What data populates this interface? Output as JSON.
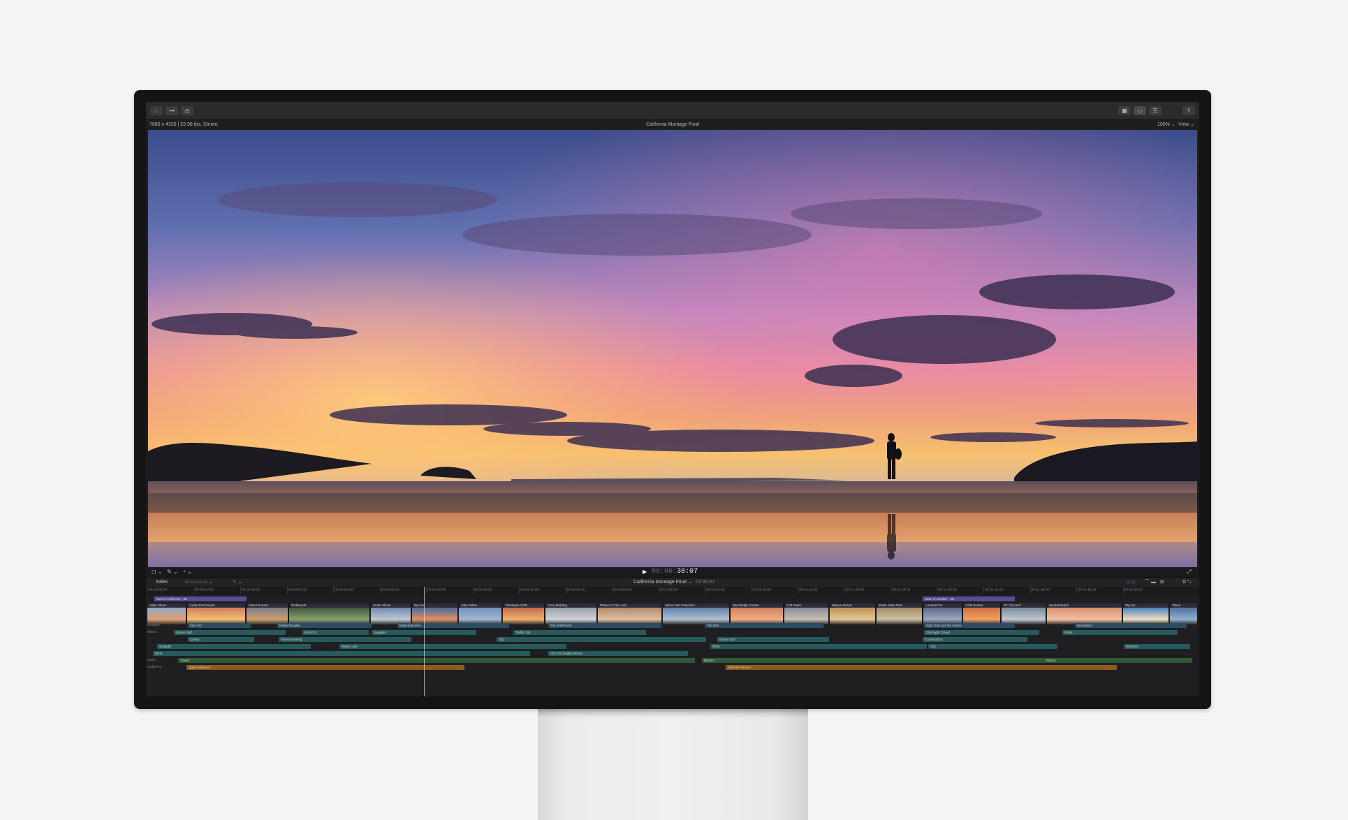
{
  "toolbar": {
    "left_icons": [
      "import-icon",
      "keywords-icon",
      "background-tasks-icon"
    ],
    "right_icons": [
      "browser-view-icon",
      "timeline-view-icon",
      "inspector-icon",
      "share-icon"
    ]
  },
  "viewer": {
    "format_info": "7680 x 4320 | 23.98 fps, Stereo",
    "title": "California Montage Final",
    "zoom": "100% ⌄",
    "view_menu": "View ⌄"
  },
  "transport": {
    "timecode_dim": "00:00:",
    "timecode": "30:07",
    "play_icon": "▶",
    "fullscreen_icon": "⤢"
  },
  "timeline_bar": {
    "index_label": "Index",
    "project_name": "California Montage Final ⌄",
    "project_duration": "01:55:07"
  },
  "ruler": [
    "00:00:05:00",
    "00:00:10:00",
    "00:00:15:00",
    "00:00:20:00",
    "00:00:25:00",
    "00:00:30:00",
    "00:00:35:00",
    "00:00:40:00",
    "00:00:45:00",
    "00:00:50:00",
    "00:00:55:00",
    "00:01:00:00",
    "00:01:05:00",
    "00:01:10:00",
    "00:01:15:00",
    "00:01:20:00",
    "00:01:25:00",
    "00:01:30:00",
    "00:01:35:00",
    "00:01:40:00",
    "00:01:45:00",
    "00:01:50:00"
  ],
  "roles": [
    "Dialogue",
    "Effects",
    "Music",
    "Ambience"
  ],
  "title_clips": [
    "Best of California - 3D",
    "State of Wonder - 3D"
  ],
  "video_clips": [
    "Misty Shore",
    "Lands End Sunset",
    "Island Sunset",
    "Redwoods",
    "South Shore",
    "Big Sur",
    "Lake Tahoe",
    "Timelapse GGB",
    "Ferry Building",
    "Palace of Fine Arts",
    "Above San Francisco",
    "Bay Bridge Sunset",
    "Coit Tower",
    "Mojave Desert",
    "Bodie State Park",
    "Lombard St.",
    "GGB Sunset",
    "SF City Hall",
    "Sunset Beach",
    "Big Sur",
    "Tahoe"
  ],
  "dialogue_clips": [
    "Intro VO",
    "Native Peoples",
    "Early Explorers",
    "The Gold Rush",
    "The 60's",
    "High Tech and the Future",
    "Recreation"
  ],
  "effects_row1": [
    "Ocean Surf",
    "Birds FX",
    "Seagulls",
    "Traffic City",
    "City Night Crowd",
    "Parks"
  ],
  "effects_row2": [
    "Crowd",
    "Forest Evening",
    "City",
    "Ocean Surf",
    "Construction"
  ],
  "effects_row3": [
    "Seagulls",
    "Water Lake",
    "Wind",
    "City",
    "Beaches"
  ],
  "effects_row4": [
    "Wind",
    "City Fire Engine Sirens"
  ],
  "music_clips": [
    "Travel",
    "Modern",
    "Nature"
  ],
  "ambience_clips": [
    "Quiet Ambience",
    "Shimmer Motion"
  ]
}
